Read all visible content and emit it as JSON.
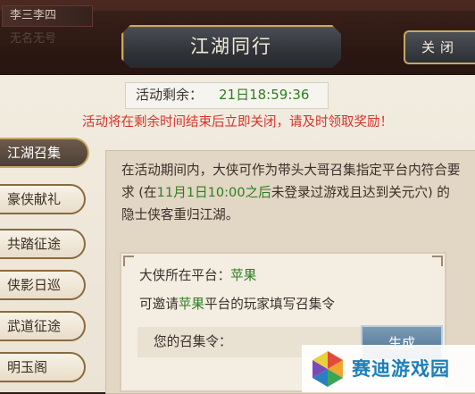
{
  "background": {
    "top_partial_text": "...",
    "names": [
      "李三李四",
      "无名无号"
    ]
  },
  "header": {
    "title": "江湖同行",
    "close_label": "关闭"
  },
  "timer": {
    "label": "活动剩余：",
    "value": "21日18:59:36"
  },
  "warning": "活动将在剩余时间结束后立即关闭，请及时领取奖励！",
  "tabs": [
    {
      "label": "江湖召集",
      "active": true
    },
    {
      "label": "豪侠献礼",
      "active": false
    },
    {
      "label": "共踏征途",
      "active": false
    },
    {
      "label": "侠影日巡",
      "active": false
    },
    {
      "label": "武道征途",
      "active": false
    },
    {
      "label": "明玉阁",
      "active": false
    }
  ],
  "description": {
    "part1": "在活动期间内，大侠可作为带头大哥召集指定平台内符合要求 (在",
    "highlight": "11月1日10:00之后",
    "part2": "未登录过游戏且达到关元穴) 的隐士侠客重归江湖。"
  },
  "platform": {
    "label": "大侠所在平台：",
    "value": "苹果",
    "invite_prefix": "可邀请",
    "invite_platform": "苹果",
    "invite_suffix": "平台的玩家填写召集令"
  },
  "code": {
    "label": "您的召集令：",
    "value": "",
    "generate_label": "生成"
  },
  "watermark": {
    "text": "赛迪游戏园"
  },
  "colors": {
    "accent_gold": "#caa95c",
    "highlight_green": "#2f7d21",
    "warning_red": "#d8322a"
  }
}
